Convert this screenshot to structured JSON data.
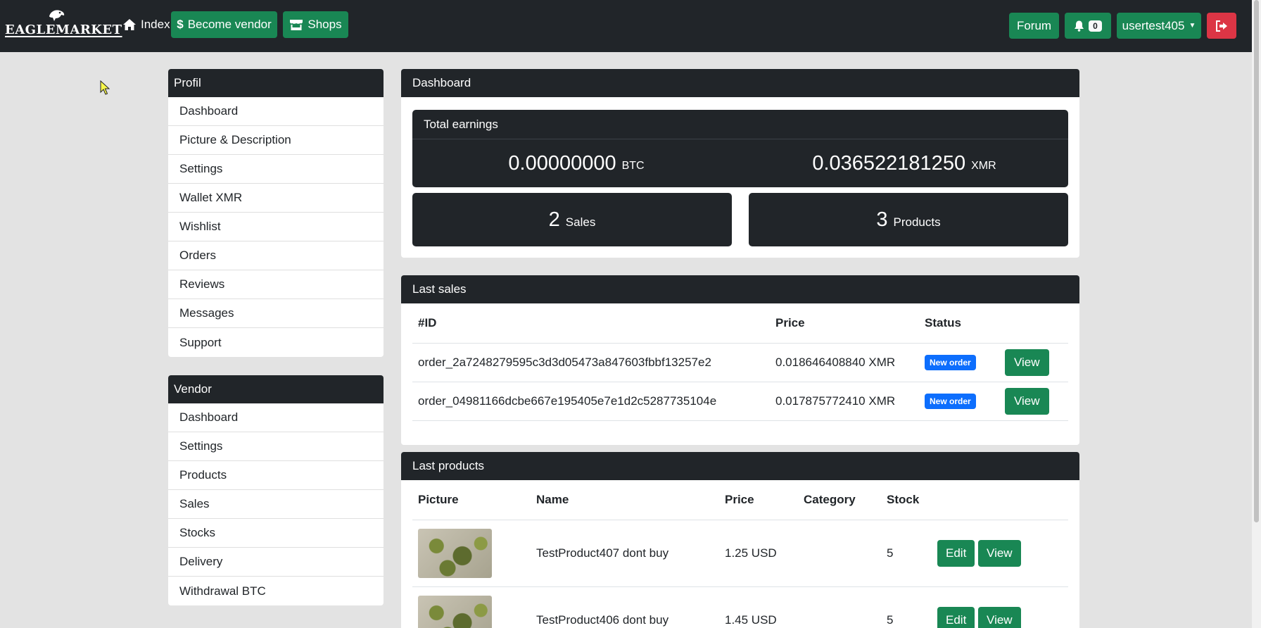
{
  "brand": {
    "name": "EAGLEMARKET"
  },
  "nav": {
    "index_label": "Index",
    "become_vendor_label": "Become vendor",
    "shops_label": "Shops",
    "forum_label": "Forum",
    "notifications_count": "0",
    "username": "usertest405"
  },
  "profile_menu": {
    "title": "Profil",
    "items": [
      "Dashboard",
      "Picture & Description",
      "Settings",
      "Wallet XMR",
      "Wishlist",
      "Orders",
      "Reviews",
      "Messages",
      "Support"
    ]
  },
  "vendor_menu": {
    "title": "Vendor",
    "items": [
      "Dashboard",
      "Settings",
      "Products",
      "Sales",
      "Stocks",
      "Delivery",
      "Withdrawal BTC"
    ]
  },
  "dashboard": {
    "title": "Dashboard",
    "earnings_title": "Total earnings",
    "btc_value": "0.00000000",
    "btc_unit": "BTC",
    "xmr_value": "0.036522181250",
    "xmr_unit": "XMR",
    "sales_count": "2",
    "sales_label": "Sales",
    "products_count": "3",
    "products_label": "Products"
  },
  "last_sales": {
    "title": "Last sales",
    "headers": {
      "id": "#ID",
      "price": "Price",
      "status": "Status"
    },
    "rows": [
      {
        "id": "order_2a7248279595c3d3d05473a847603fbbf13257e2",
        "price": "0.018646408840 XMR",
        "status": "New order",
        "action": "View"
      },
      {
        "id": "order_04981166dcbe667e195405e7e1d2c5287735104e",
        "price": "0.017875772410 XMR",
        "status": "New order",
        "action": "View"
      }
    ]
  },
  "last_products": {
    "title": "Last products",
    "headers": {
      "picture": "Picture",
      "name": "Name",
      "price": "Price",
      "category": "Category",
      "stock": "Stock"
    },
    "rows": [
      {
        "name": "TestProduct407 dont buy",
        "price": "1.25 USD",
        "category": "",
        "stock": "5",
        "edit": "Edit",
        "view": "View"
      },
      {
        "name": "TestProduct406 dont buy",
        "price": "1.45 USD",
        "category": "",
        "stock": "5",
        "edit": "Edit",
        "view": "View"
      }
    ]
  },
  "colors": {
    "navbar": "#212529",
    "success": "#198754",
    "danger": "#dc3545",
    "primary": "#0d6efd",
    "background": "#e3e3e3"
  }
}
